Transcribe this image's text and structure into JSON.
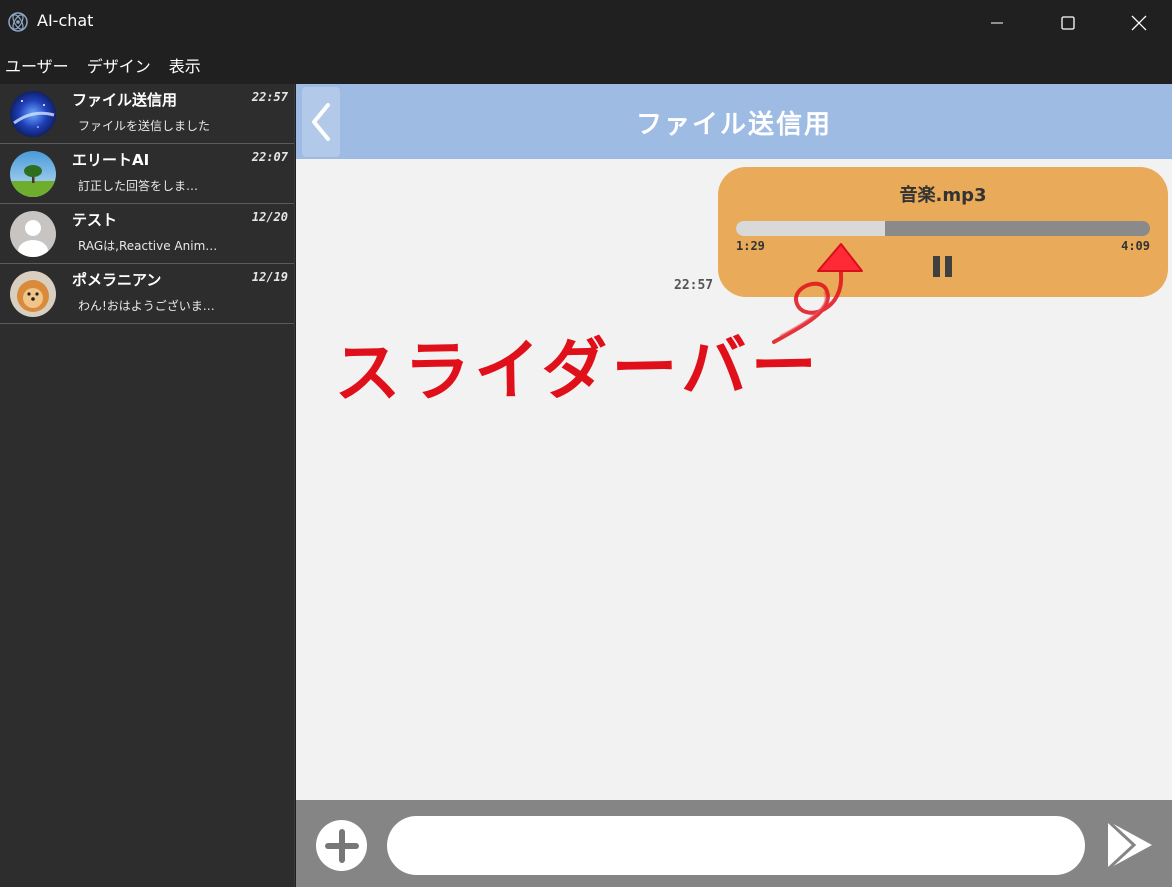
{
  "window": {
    "title": "AI-chat"
  },
  "menu": {
    "items": [
      "ユーザー",
      "デザイン",
      "表示"
    ]
  },
  "sidebar": {
    "chats": [
      {
        "name": "ファイル送信用",
        "time": "22:57",
        "preview": "ファイルを送信しました",
        "avatar": "galaxy-avatar"
      },
      {
        "name": "エリートAI",
        "time": "22:07",
        "preview": "訂正した回答をしま…",
        "avatar": "tree-field-avatar"
      },
      {
        "name": "テスト",
        "time": "12/20",
        "preview": "RAGは,Reactive Anim…",
        "avatar": "default-user-avatar"
      },
      {
        "name": "ポメラニアン",
        "time": "12/19",
        "preview": "わん!おはようございま…",
        "avatar": "pomeranian-avatar"
      }
    ]
  },
  "chat": {
    "title": "ファイル送信用",
    "message": {
      "time": "22:57",
      "filename": "音楽.mp3",
      "current_time": "1:29",
      "total_time": "4:09",
      "progress": 0.36
    },
    "annotation": "スライダーバー"
  },
  "input": {
    "placeholder": ""
  },
  "colors": {
    "header": "#9ebbe4",
    "bubble": "#e9aa59",
    "annotation": "#e0101a",
    "sidebar": "#2d2d2d"
  }
}
